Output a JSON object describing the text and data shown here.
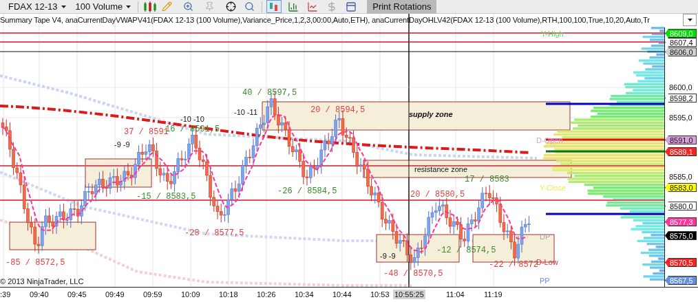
{
  "toolbar": {
    "instrument": "FDAX 12-13",
    "interval": "100 Volume",
    "print_button": "Print Rotations",
    "chart_styles": [
      {
        "selected": true
      },
      {
        "selected": false
      },
      {
        "selected": false
      },
      {
        "selected": false
      },
      {
        "selected": false
      }
    ]
  },
  "indicator_legend": "Summary Tape V4, anaCurrentDayVWAPV41(FDAX 12-13 (100 Volume),Variance_Price,1,2,3,00:00,Auto,ETH), anaCurrentDayOHLV42(FDAX 12-13 (100 Volume),RTH,100,100,True,10,20,Auto,Tr",
  "chart": {
    "swing_labels": [
      {
        "text": "-85 / 8572,5",
        "color": "#e04040"
      },
      {
        "text": "37 / 8591",
        "color": "#e04040"
      },
      {
        "text": "16 / 8591,5",
        "color": "#3a8a2a"
      },
      {
        "text": "-15 / 8583,5",
        "color": "#3a8a2a"
      },
      {
        "text": "-28 / 8577,5",
        "color": "#e04040"
      },
      {
        "text": "40 / 8597,5",
        "color": "#3a8a2a"
      },
      {
        "text": "20 / 8594,5",
        "color": "#e04040"
      },
      {
        "text": "-26 / 8584,5",
        "color": "#3a8a2a"
      },
      {
        "text": "20 / 8580,5",
        "color": "#e04040"
      },
      {
        "text": "17 / 8583",
        "color": "#3a8a2a"
      },
      {
        "text": "-12 / 8574,5",
        "color": "#3a8a2a"
      },
      {
        "text": "-48 / 8570,5",
        "color": "#e04040"
      },
      {
        "text": "-22 / 8572",
        "color": "#e04040"
      }
    ],
    "counts": [
      "-9 -9",
      "-10 -10",
      "-10 -11",
      "-9 -9"
    ],
    "zones": [
      "supply zone",
      "resistance zone"
    ],
    "level_labels": [
      {
        "text": "Y-High",
        "color": "#60d060"
      },
      {
        "text": "D-Open",
        "color": "#d8a0d8"
      },
      {
        "text": "Y-Close",
        "color": "#eeee50"
      },
      {
        "text": "DP",
        "color": "#a8a8a8"
      },
      {
        "text": "D-Low",
        "color": "#e03030"
      },
      {
        "text": "PP",
        "color": "#7090e0"
      }
    ],
    "copyright": "© 2013 NinjaTrader, LLC"
  },
  "price_axis": {
    "ticks": [
      "8600,0",
      "8595,0",
      "8585,0"
    ],
    "tags": [
      {
        "text": "8609,0",
        "color": "#00e000"
      },
      {
        "text": "8607,4",
        "color": "#ffffff"
      },
      {
        "text": "8606,0",
        "color": "#d0d0d0"
      },
      {
        "text": "8598,2",
        "color": "#ffffff"
      },
      {
        "text": "8591,0",
        "color": "#d8a0d8"
      },
      {
        "text": "8589,1",
        "color": "#ff2020"
      },
      {
        "text": "8583,0",
        "color": "#ffff00"
      },
      {
        "text": "8580,0",
        "color": "#ffffff"
      },
      {
        "text": "8577,3",
        "color": "#ff3399"
      },
      {
        "text": "8575,0",
        "color": "#000000"
      },
      {
        "text": "8570,5",
        "color": "#ff2020"
      },
      {
        "text": "8567,5",
        "color": "#6090e0"
      }
    ]
  },
  "time_axis": {
    "labels": [
      ":39",
      "09:40",
      "09:45",
      "09:49",
      "09:59",
      "10:09",
      "10:18",
      "10:26",
      "10:34",
      "10:44",
      "10:53",
      "11:04",
      "11:19"
    ],
    "cursor_time": "10:55:25"
  }
}
